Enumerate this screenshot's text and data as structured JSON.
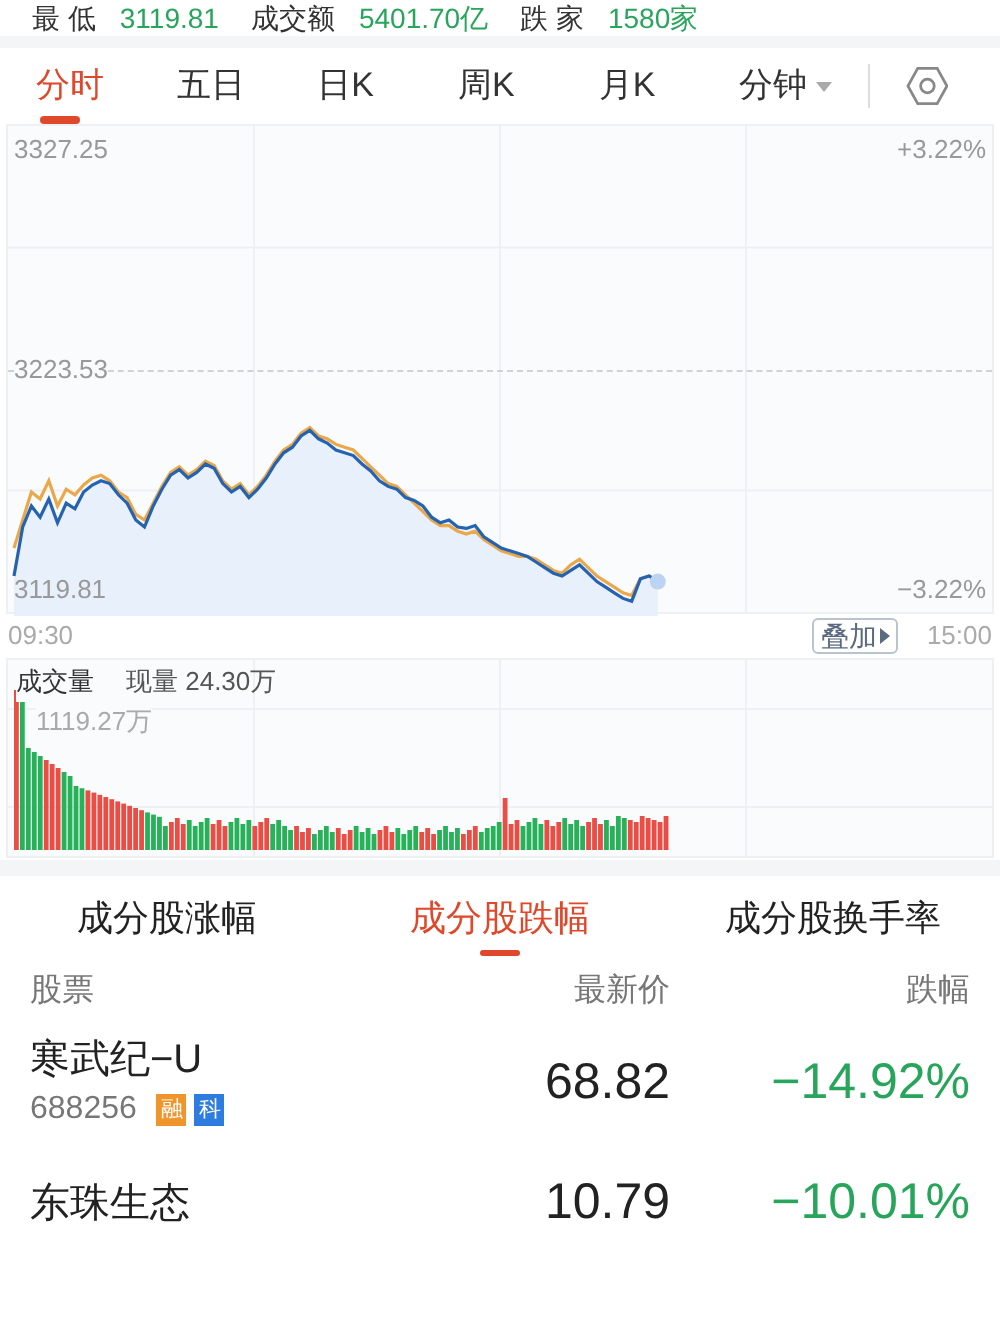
{
  "summary": [
    {
      "label": "最 低",
      "value": "3119.81"
    },
    {
      "label": "成交额",
      "value": "5401.70亿"
    },
    {
      "label": "跌 家",
      "value": "1580家"
    }
  ],
  "period_tabs": [
    {
      "label": "分时",
      "selected": true,
      "dropdown": false
    },
    {
      "label": "五日",
      "selected": false,
      "dropdown": false
    },
    {
      "label": "日K",
      "selected": false,
      "dropdown": false
    },
    {
      "label": "周K",
      "selected": false,
      "dropdown": false
    },
    {
      "label": "月K",
      "selected": false,
      "dropdown": false
    },
    {
      "label": "分钟",
      "selected": false,
      "dropdown": true
    }
  ],
  "price_chart": {
    "high": "3327.25",
    "high_pct": "+3.22%",
    "mid": "3223.53",
    "low": "3119.81",
    "low_pct": "−3.22%",
    "start_time": "09:30",
    "end_time": "15:00",
    "overlay_button": "叠加"
  },
  "volume_chart": {
    "title": "成交量",
    "current": "现量 24.30万",
    "max": "1119.27万"
  },
  "list_tabs": [
    {
      "label": "成分股涨幅",
      "selected": false
    },
    {
      "label": "成分股跌幅",
      "selected": true
    },
    {
      "label": "成分股换手率",
      "selected": false
    }
  ],
  "table": {
    "columns": [
      "股票",
      "最新价",
      "跌幅"
    ],
    "rows": [
      {
        "name": "寒武纪−U",
        "code": "688256",
        "tags": [
          {
            "label": "融",
            "color": "#f0952c"
          },
          {
            "label": "科",
            "color": "#2f7ce0"
          }
        ],
        "price": "68.82",
        "change": "−14.92%"
      },
      {
        "name": "东珠生态",
        "code": "",
        "tags": [],
        "price": "10.79",
        "change": "−10.01%"
      }
    ]
  }
}
